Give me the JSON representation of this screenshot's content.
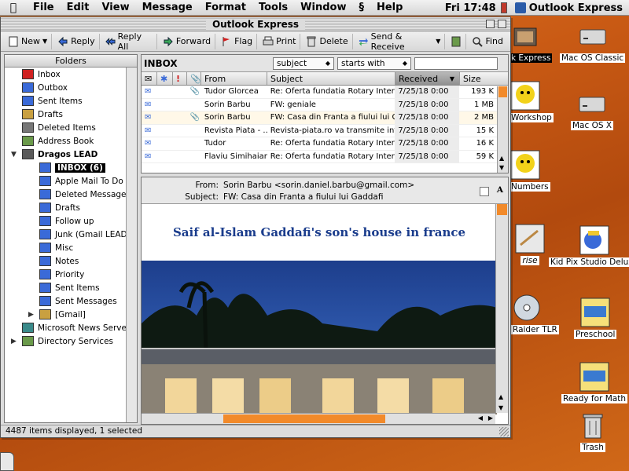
{
  "menubar": {
    "items": [
      "File",
      "Edit",
      "View",
      "Message",
      "Format",
      "Tools",
      "Window",
      "Help"
    ],
    "clock": "Fri 17:48",
    "app_name": "Outlook Express"
  },
  "window": {
    "title": "Outlook Express"
  },
  "toolbar": {
    "new": "New",
    "reply": "Reply",
    "reply_all": "Reply All",
    "forward": "Forward",
    "flag": "Flag",
    "print": "Print",
    "delete": "Delete",
    "send_receive": "Send & Receive",
    "find": "Find"
  },
  "folders": {
    "header": "Folders",
    "items": [
      {
        "label": "Inbox"
      },
      {
        "label": "Outbox"
      },
      {
        "label": "Sent Items"
      },
      {
        "label": "Drafts"
      },
      {
        "label": "Deleted Items"
      },
      {
        "label": "Address Book"
      },
      {
        "label": "Dragos LEAD"
      },
      {
        "label": "INBOX (6)"
      },
      {
        "label": "Apple Mail To Do"
      },
      {
        "label": "Deleted Messages"
      },
      {
        "label": "Drafts"
      },
      {
        "label": "Follow up"
      },
      {
        "label": "Junk (Gmail LEAD)"
      },
      {
        "label": "Misc"
      },
      {
        "label": "Notes"
      },
      {
        "label": "Priority"
      },
      {
        "label": "Sent Items"
      },
      {
        "label": "Sent Messages"
      },
      {
        "label": "[Gmail]"
      },
      {
        "label": "Microsoft News Server"
      },
      {
        "label": "Directory Services"
      }
    ]
  },
  "list": {
    "folder_title": "INBOX",
    "filter_field": "subject",
    "filter_op": "starts with",
    "filter_value": "",
    "columns": {
      "from": "From",
      "subject": "Subject",
      "received": "Received",
      "size": "Size"
    },
    "rows": [
      {
        "from": "Tudor Glorcea",
        "subject": "Re: Oferta fundatia Rotary Internatio...",
        "received": "7/25/18 0:00",
        "size": "193 K"
      },
      {
        "from": "Sorin Barbu",
        "subject": "FW: geniale",
        "received": "7/25/18 0:00",
        "size": "1 MB"
      },
      {
        "from": "Sorin Barbu",
        "subject": "FW: Casa din Franta a fiului lui Gaddafi",
        "received": "7/25/18 0:00",
        "size": "2 MB"
      },
      {
        "from": "Revista Piata - ...",
        "subject": "Revista-piata.ro va transmite inform...",
        "received": "7/25/18 0:00",
        "size": "15 K"
      },
      {
        "from": "Tudor",
        "subject": "Re: Oferta fundatia Rotary Internatio...",
        "received": "7/25/18 0:00",
        "size": "16 K"
      },
      {
        "from": "Flaviu Simihaian",
        "subject": "Re: Oferta fundatia Rotary Internatio...",
        "received": "7/25/18 0:00",
        "size": "59 K"
      }
    ]
  },
  "preview": {
    "from_label": "From:",
    "from_value": "Sorin Barbu <sorin.daniel.barbu@gmail.com>",
    "subject_label": "Subject:",
    "subject_value": "FW: Casa din Franta a fiului lui Gaddafi",
    "body_title": "Saif al-Islam Gaddafi's son's house in france"
  },
  "status": "4487 items displayed, 1 selected",
  "desktop": {
    "icons": [
      {
        "label": "Mac OS Classic"
      },
      {
        "label": "Mac OS X"
      },
      {
        "label": "k Express"
      },
      {
        "label": "Workshop"
      },
      {
        "label": "Numbers"
      },
      {
        "label": "rise"
      },
      {
        "label": "Kid Pix Studio Deluxe"
      },
      {
        "label": "Raider TLR"
      },
      {
        "label": "Preschool"
      },
      {
        "label": "Ready for Math"
      },
      {
        "label": "Trash"
      }
    ]
  },
  "colors": {
    "accent": "#1a3c8c",
    "desktop": "#c95a14",
    "selection": "#000000"
  }
}
